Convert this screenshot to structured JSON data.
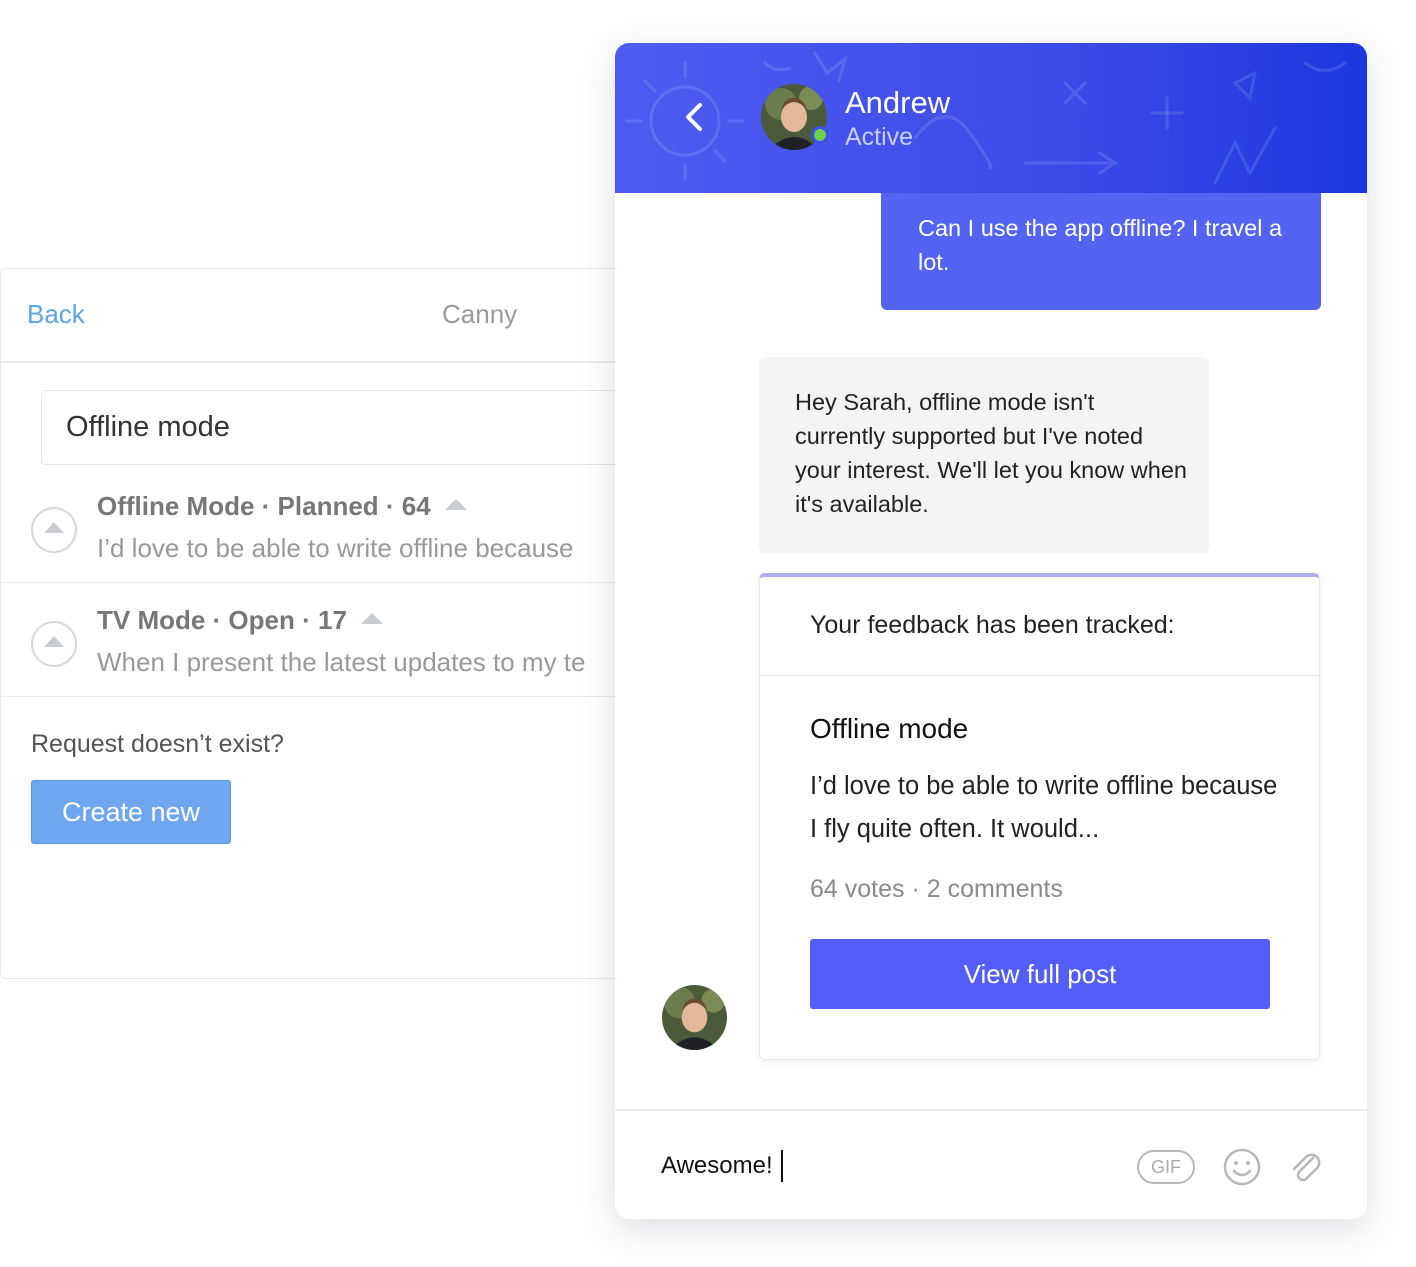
{
  "canny": {
    "back_label": "Back",
    "title": "Canny",
    "search_value": "Offline mode",
    "posts": [
      {
        "title": "Offline Mode · Planned · 64",
        "description": "I’d love to be able to write offline because"
      },
      {
        "title": "TV Mode · Open · 17",
        "description": "When I present the latest updates to my te"
      }
    ],
    "prompt": "Request doesn’t exist?",
    "create_label": "Create new"
  },
  "chat": {
    "agent_name": "Andrew",
    "agent_status": "Active",
    "status_color": "#6bd04a",
    "header_color": "#3c4be8",
    "user_message": "Can I use the app offline? I travel a lot.",
    "agent_message": "Hey Sarah, offline mode isn't currently supported but I've noted your interest. We'll let you know when it's available.",
    "card": {
      "heading": "Your feedback has been tracked:",
      "post_title": "Offline mode",
      "post_excerpt": "I’d love to be able to write offline because I fly quite often. It would...",
      "meta": "64 votes · 2 comments",
      "button_label": "View full post",
      "button_color": "#525ef7"
    },
    "composer": {
      "value": "Awesome!",
      "gif_label": "GIF",
      "emoji_icon": "smiley-icon",
      "attach_icon": "paperclip-icon"
    }
  }
}
